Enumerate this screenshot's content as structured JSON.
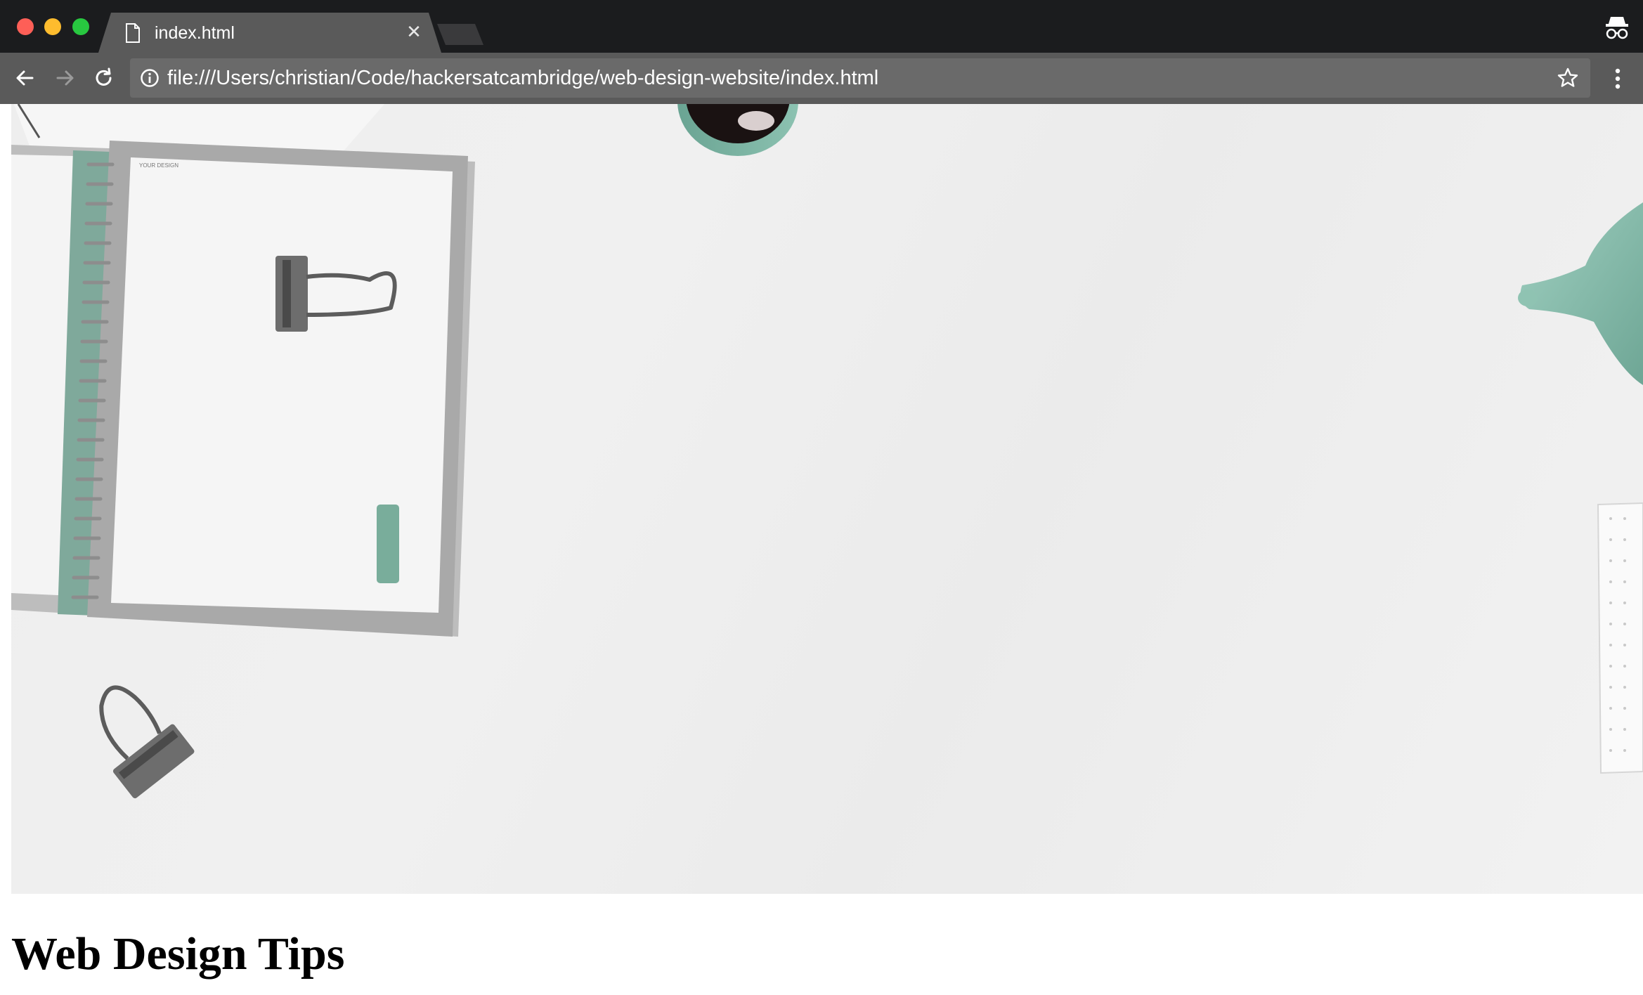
{
  "browser": {
    "tab": {
      "title": "index.html",
      "icon": "document-icon",
      "close_icon": "close-icon"
    },
    "new_tab": {
      "icon": "new-tab-icon"
    },
    "profile": {
      "icon": "incognito-icon"
    },
    "nav": {
      "back_icon": "arrow-left-icon",
      "forward_icon": "arrow-right-icon",
      "reload_icon": "reload-icon"
    },
    "address_bar": {
      "info_icon": "info-icon",
      "url": "file:///Users/christian/Code/hackersatcambridge/web-design-website/index.html",
      "bookmark_icon": "star-icon"
    },
    "menu_icon": "kebab-menu-icon",
    "colors": {
      "titlebar": "#1b1c1e",
      "toolbar": "#5a5a5a",
      "omnibox": "#6a6a6a",
      "close_dot": "#fe5f57",
      "minimize_dot": "#febc2e",
      "maximize_dot": "#28c840"
    }
  },
  "page": {
    "hero_image": {
      "description_icon": "desk-flatlay-image",
      "accent_color": "#7fb3a3"
    },
    "heading": "Web Design Tips"
  }
}
